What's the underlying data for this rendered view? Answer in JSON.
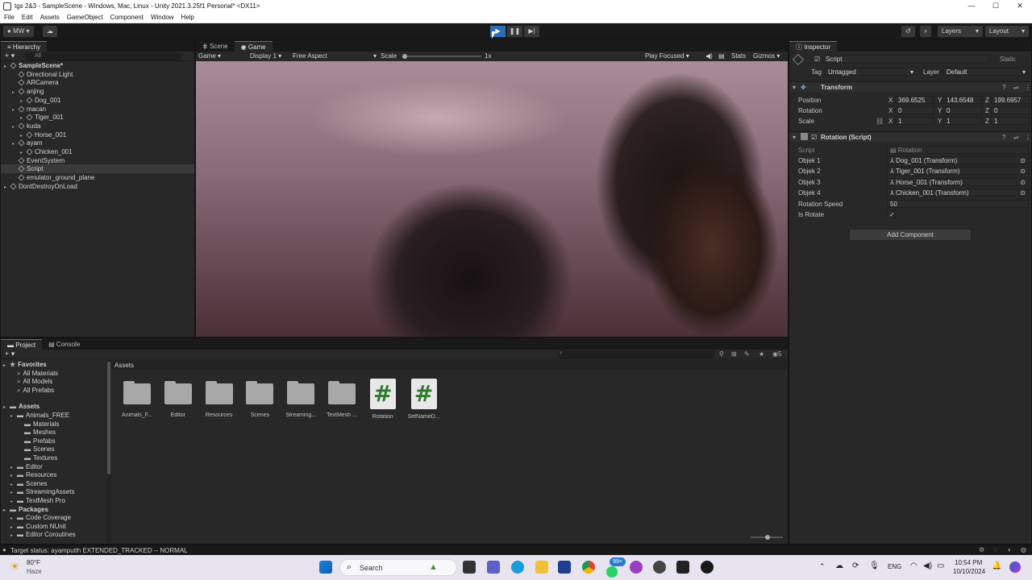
{
  "window": {
    "title": "tgs 2&3 - SampleScene - Windows, Mac, Linux - Unity 2021.3.25f1 Personal* <DX11>",
    "controls": [
      "—",
      "☐",
      "✕"
    ]
  },
  "menu": [
    "File",
    "Edit",
    "Assets",
    "GameObject",
    "Component",
    "Window",
    "Help"
  ],
  "toolbar": {
    "account": "MW",
    "layers": "Layers",
    "layout": "Layout"
  },
  "hierarchy": {
    "tab": "Hierarchy",
    "search_placeholder": "All",
    "items": [
      {
        "label": "SampleScene*",
        "depth": 0
      },
      {
        "label": "Directional Light",
        "depth": 1
      },
      {
        "label": "ARCamera",
        "depth": 1
      },
      {
        "label": "anjing",
        "depth": 1
      },
      {
        "label": "Dog_001",
        "depth": 2
      },
      {
        "label": "macan",
        "depth": 1
      },
      {
        "label": "Tiger_001",
        "depth": 2
      },
      {
        "label": "kuda",
        "depth": 1
      },
      {
        "label": "Horse_001",
        "depth": 2
      },
      {
        "label": "ayam",
        "depth": 1
      },
      {
        "label": "Chicken_001",
        "depth": 2
      },
      {
        "label": "EventSystem",
        "depth": 1
      },
      {
        "label": "Script",
        "depth": 1
      },
      {
        "label": "emulator_ground_plane",
        "depth": 1
      },
      {
        "label": "DontDestroyOnLoad",
        "depth": 0
      }
    ]
  },
  "scene_tabs": {
    "scene": "Scene",
    "game": "Game"
  },
  "game_bar": {
    "mode": "Game",
    "display": "Display 1",
    "aspect": "Free Aspect",
    "scale_label": "Scale",
    "scale_value": "1x",
    "play_focused": "Play Focused",
    "stats": "Stats",
    "gizmos": "Gizmos"
  },
  "inspector": {
    "tab": "Inspector",
    "object_name": "Script",
    "static_label": "Static",
    "tag_label": "Tag",
    "tag_value": "Untagged",
    "layer_label": "Layer",
    "layer_value": "Default",
    "transform": {
      "title": "Transform",
      "position_label": "Position",
      "rotation_label": "Rotation",
      "scale_label": "Scale",
      "position": {
        "x": "369.6525",
        "y": "143.6548",
        "z": "199.6957"
      },
      "rotation": {
        "x": "0",
        "y": "0",
        "z": "0"
      },
      "scale": {
        "x": "1",
        "y": "1",
        "z": "1"
      }
    },
    "rotation_script": {
      "title": "Rotation (Script)",
      "script_label": "Script",
      "script_value": "Rotation",
      "objek1_label": "Objek 1",
      "objek1_value": "Dog_001 (Transform)",
      "objek2_label": "Objek 2",
      "objek2_value": "Tiger_001 (Transform)",
      "objek3_label": "Objek 3",
      "objek3_value": "Horse_001 (Transform)",
      "objek4_label": "Objek 4",
      "objek4_value": "Chicken_001 (Transform)",
      "speed_label": "Rotation Speed",
      "speed_value": "50",
      "is_rotate_label": "Is Rotate",
      "is_rotate_value": "✓"
    },
    "add_component": "Add Component"
  },
  "project": {
    "tab_project": "Project",
    "tab_console": "Console",
    "breadcrumb": "Assets",
    "hidden_count": "5",
    "tree": [
      {
        "label": "Favorites",
        "depth": 0,
        "bold": true
      },
      {
        "label": "All Materials",
        "depth": 1
      },
      {
        "label": "All Models",
        "depth": 1
      },
      {
        "label": "All Prefabs",
        "depth": 1
      },
      {
        "label": "Assets",
        "depth": 0,
        "bold": true,
        "gap": true
      },
      {
        "label": "Animals_FREE",
        "depth": 1
      },
      {
        "label": "Materials",
        "depth": 2
      },
      {
        "label": "Meshes",
        "depth": 2
      },
      {
        "label": "Prefabs",
        "depth": 2
      },
      {
        "label": "Scenes",
        "depth": 2
      },
      {
        "label": "Textures",
        "depth": 2
      },
      {
        "label": "Editor",
        "depth": 1
      },
      {
        "label": "Resources",
        "depth": 1
      },
      {
        "label": "Scenes",
        "depth": 1
      },
      {
        "label": "StreamingAssets",
        "depth": 1
      },
      {
        "label": "TextMesh Pro",
        "depth": 1
      },
      {
        "label": "Packages",
        "depth": 0,
        "bold": true
      },
      {
        "label": "Code Coverage",
        "depth": 1
      },
      {
        "label": "Custom NUnit",
        "depth": 1
      },
      {
        "label": "Editor Coroutines",
        "depth": 1
      }
    ],
    "assets": [
      {
        "label": "Animals_F...",
        "kind": "folder"
      },
      {
        "label": "Editor",
        "kind": "folder"
      },
      {
        "label": "Resources",
        "kind": "folder"
      },
      {
        "label": "Scenes",
        "kind": "folder"
      },
      {
        "label": "Streaming...",
        "kind": "folder"
      },
      {
        "label": "TextMesh ...",
        "kind": "folder"
      },
      {
        "label": "Rotation",
        "kind": "script"
      },
      {
        "label": "SetNameD...",
        "kind": "script"
      }
    ]
  },
  "status_bar": "Target status: ayamputih EXTENDED_TRACKED -- NORMAL",
  "taskbar": {
    "weather_temp": "80°F",
    "weather_desc": "Haze",
    "search": "Search",
    "badge": "99+",
    "lang": "ENG",
    "time": "10:54 PM",
    "date": "10/10/2024"
  }
}
